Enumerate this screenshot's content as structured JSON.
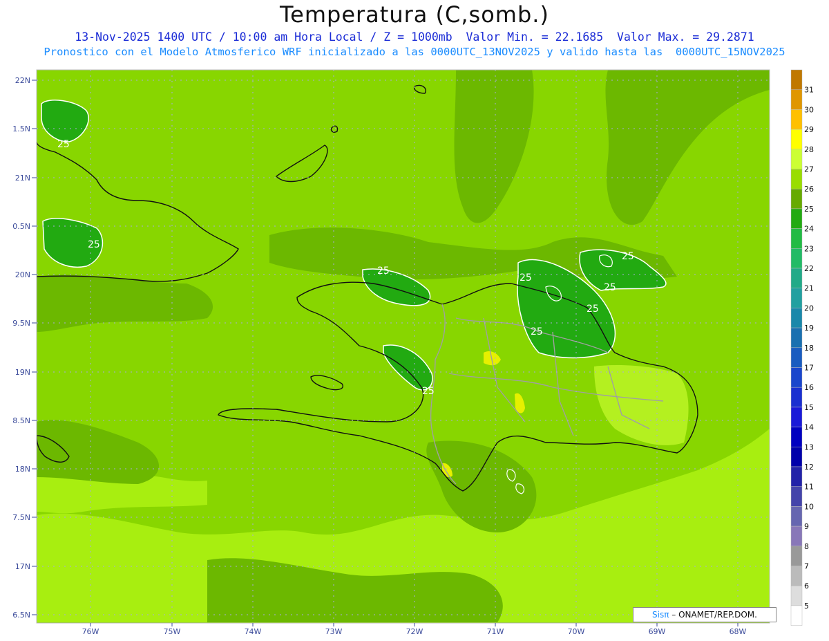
{
  "title": "Temperatura (C,somb.)",
  "subtitle_line1": "13-Nov-2025 1400 UTC / 10:00 am Hora Local / Z = 1000mb  Valor Min. = 22.1685  Valor Max. = 29.2871",
  "subtitle_line2": "Pronostico con el Modelo Atmosferico WRF inicializado a las 0000UTC_13NOV2025 y valido hasta las  0000UTC_15NOV2025",
  "credit": {
    "brand": "Sisπ",
    "text": " – ONAMET/REP.DOM."
  },
  "map": {
    "lat_labels": [
      "22N",
      "1.5N",
      "21N",
      "0.5N",
      "20N",
      "9.5N",
      "19N",
      "8.5N",
      "18N",
      "7.5N",
      "17N",
      "6.5N"
    ],
    "lon_labels": [
      "76W",
      "75W",
      "74W",
      "73W",
      "72W",
      "71W",
      "70W",
      "69W",
      "68W"
    ],
    "contour_labels": [
      "25",
      "25",
      "25",
      "25",
      "25",
      "25",
      "25",
      "25",
      "25"
    ]
  },
  "colorbar": {
    "levels": [
      "31",
      "30",
      "29",
      "28",
      "27",
      "26",
      "25",
      "24",
      "23",
      "22",
      "21",
      "20",
      "19",
      "18",
      "17",
      "16",
      "15",
      "14",
      "13",
      "12",
      "11",
      "10",
      "9",
      "8",
      "7",
      "6",
      "5"
    ],
    "colors": [
      "#c07800",
      "#e09600",
      "#ffc000",
      "#ffff00",
      "#ccff33",
      "#99dd00",
      "#66aa00",
      "#22aa11",
      "#22bb44",
      "#22bb66",
      "#22aa88",
      "#22a0a0",
      "#1a88aa",
      "#1a70b0",
      "#1a5cc0",
      "#1a46cc",
      "#1a30d0",
      "#1a1ad8",
      "#0000c0",
      "#0000aa",
      "#2222a8",
      "#4444aa",
      "#6666b0",
      "#8877b8",
      "#999999",
      "#bbbbbb",
      "#dddddd",
      "#ffffff"
    ]
  }
}
